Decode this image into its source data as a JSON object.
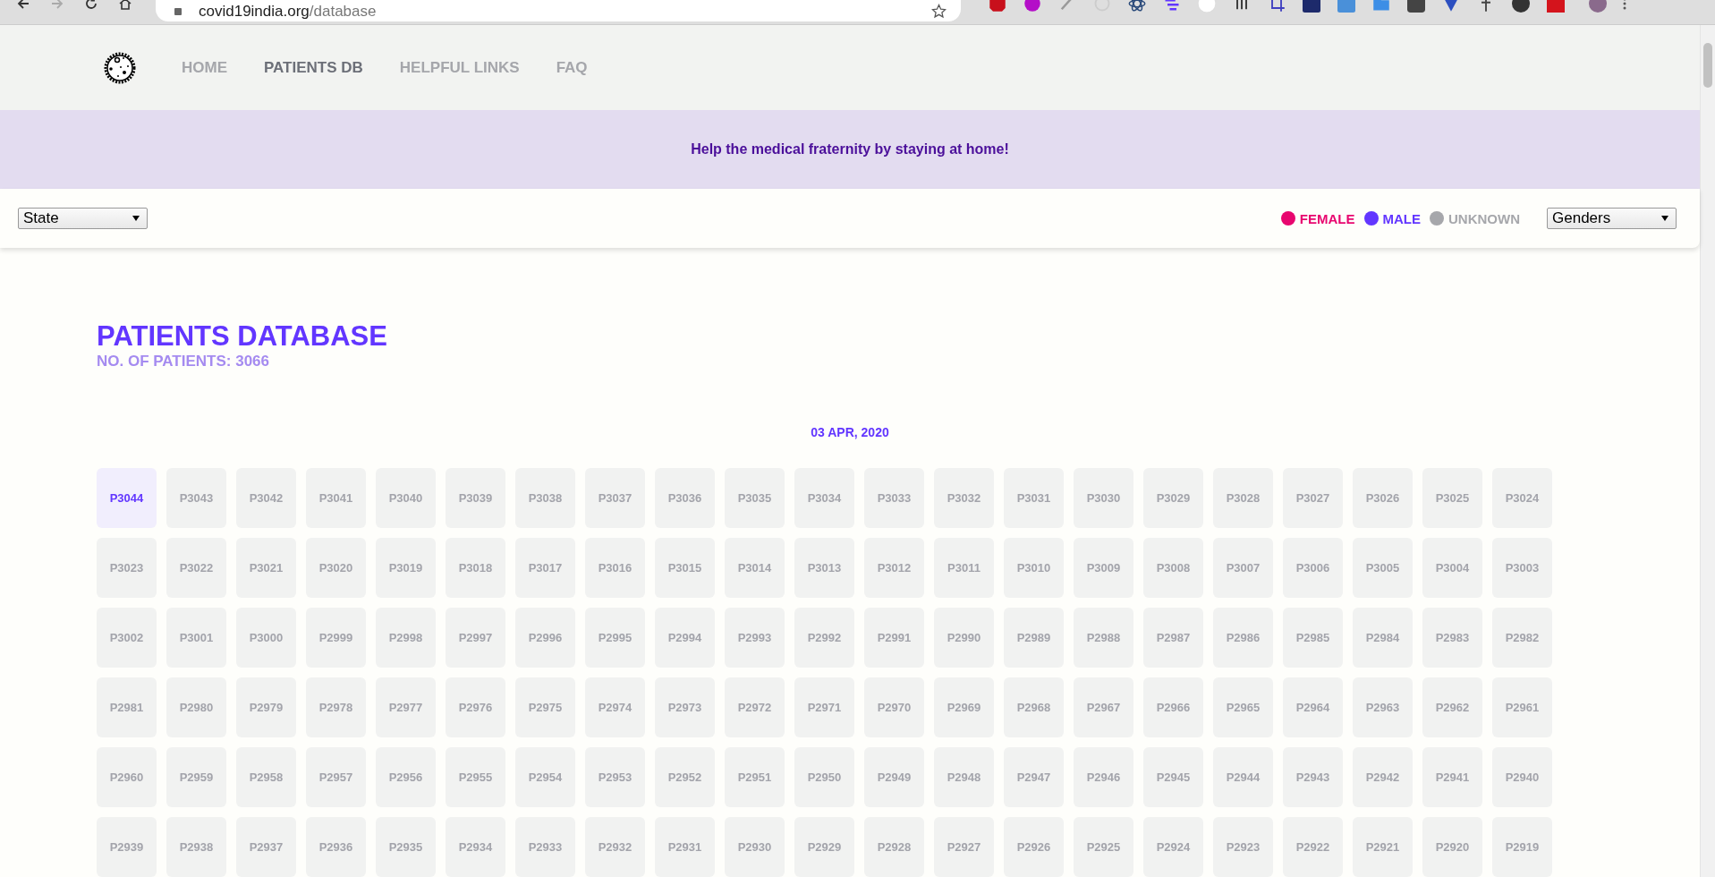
{
  "browser": {
    "url_host": "covid19india.org",
    "url_path": "/database"
  },
  "nav": {
    "items": [
      {
        "label": "HOME",
        "selected": false
      },
      {
        "label": "PATIENTS DB",
        "selected": true
      },
      {
        "label": "HELPFUL LINKS",
        "selected": false
      },
      {
        "label": "FAQ",
        "selected": false
      }
    ]
  },
  "banner": {
    "text": "Help the medical fraternity by staying at home!"
  },
  "filters": {
    "state_select": "State",
    "gender_select": "Genders",
    "legend": [
      {
        "label": "FEMALE",
        "color": "#e8066f"
      },
      {
        "label": "MALE",
        "color": "#6236ff"
      },
      {
        "label": "UNKNOWN",
        "color": "#a6a7ab"
      }
    ]
  },
  "header": {
    "title": "PATIENTS DATABASE",
    "count": "NO. OF PATIENTS: 3066"
  },
  "date": "03 APR, 2020",
  "patients": [
    {
      "label": "P3044",
      "selected": true
    },
    {
      "label": "P3043",
      "selected": false
    },
    {
      "label": "P3042",
      "selected": false
    },
    {
      "label": "P3041",
      "selected": false
    },
    {
      "label": "P3040",
      "selected": false
    },
    {
      "label": "P3039",
      "selected": false
    },
    {
      "label": "P3038",
      "selected": false
    },
    {
      "label": "P3037",
      "selected": false
    },
    {
      "label": "P3036",
      "selected": false
    },
    {
      "label": "P3035",
      "selected": false
    },
    {
      "label": "P3034",
      "selected": false
    },
    {
      "label": "P3033",
      "selected": false
    },
    {
      "label": "P3032",
      "selected": false
    },
    {
      "label": "P3031",
      "selected": false
    },
    {
      "label": "P3030",
      "selected": false
    },
    {
      "label": "P3029",
      "selected": false
    },
    {
      "label": "P3028",
      "selected": false
    },
    {
      "label": "P3027",
      "selected": false
    },
    {
      "label": "P3026",
      "selected": false
    },
    {
      "label": "P3025",
      "selected": false
    },
    {
      "label": "P3024",
      "selected": false
    },
    {
      "label": "P3023",
      "selected": false
    },
    {
      "label": "P3022",
      "selected": false
    },
    {
      "label": "P3021",
      "selected": false
    },
    {
      "label": "P3020",
      "selected": false
    },
    {
      "label": "P3019",
      "selected": false
    },
    {
      "label": "P3018",
      "selected": false
    },
    {
      "label": "P3017",
      "selected": false
    },
    {
      "label": "P3016",
      "selected": false
    },
    {
      "label": "P3015",
      "selected": false
    },
    {
      "label": "P3014",
      "selected": false
    },
    {
      "label": "P3013",
      "selected": false
    },
    {
      "label": "P3012",
      "selected": false
    },
    {
      "label": "P3011",
      "selected": false
    },
    {
      "label": "P3010",
      "selected": false
    },
    {
      "label": "P3009",
      "selected": false
    },
    {
      "label": "P3008",
      "selected": false
    },
    {
      "label": "P3007",
      "selected": false
    },
    {
      "label": "P3006",
      "selected": false
    },
    {
      "label": "P3005",
      "selected": false
    },
    {
      "label": "P3004",
      "selected": false
    },
    {
      "label": "P3003",
      "selected": false
    },
    {
      "label": "P3002",
      "selected": false
    },
    {
      "label": "P3001",
      "selected": false
    },
    {
      "label": "P3000",
      "selected": false
    },
    {
      "label": "P2999",
      "selected": false
    },
    {
      "label": "P2998",
      "selected": false
    },
    {
      "label": "P2997",
      "selected": false
    },
    {
      "label": "P2996",
      "selected": false
    },
    {
      "label": "P2995",
      "selected": false
    },
    {
      "label": "P2994",
      "selected": false
    },
    {
      "label": "P2993",
      "selected": false
    },
    {
      "label": "P2992",
      "selected": false
    },
    {
      "label": "P2991",
      "selected": false
    },
    {
      "label": "P2990",
      "selected": false
    },
    {
      "label": "P2989",
      "selected": false
    },
    {
      "label": "P2988",
      "selected": false
    },
    {
      "label": "P2987",
      "selected": false
    },
    {
      "label": "P2986",
      "selected": false
    },
    {
      "label": "P2985",
      "selected": false
    },
    {
      "label": "P2984",
      "selected": false
    },
    {
      "label": "P2983",
      "selected": false
    },
    {
      "label": "P2982",
      "selected": false
    },
    {
      "label": "P2981",
      "selected": false
    },
    {
      "label": "P2980",
      "selected": false
    },
    {
      "label": "P2979",
      "selected": false
    },
    {
      "label": "P2978",
      "selected": false
    },
    {
      "label": "P2977",
      "selected": false
    },
    {
      "label": "P2976",
      "selected": false
    },
    {
      "label": "P2975",
      "selected": false
    },
    {
      "label": "P2974",
      "selected": false
    },
    {
      "label": "P2973",
      "selected": false
    },
    {
      "label": "P2972",
      "selected": false
    },
    {
      "label": "P2971",
      "selected": false
    },
    {
      "label": "P2970",
      "selected": false
    },
    {
      "label": "P2969",
      "selected": false
    },
    {
      "label": "P2968",
      "selected": false
    },
    {
      "label": "P2967",
      "selected": false
    },
    {
      "label": "P2966",
      "selected": false
    },
    {
      "label": "P2965",
      "selected": false
    },
    {
      "label": "P2964",
      "selected": false
    },
    {
      "label": "P2963",
      "selected": false
    },
    {
      "label": "P2962",
      "selected": false
    },
    {
      "label": "P2961",
      "selected": false
    },
    {
      "label": "P2960",
      "selected": false
    },
    {
      "label": "P2959",
      "selected": false
    },
    {
      "label": "P2958",
      "selected": false
    },
    {
      "label": "P2957",
      "selected": false
    },
    {
      "label": "P2956",
      "selected": false
    },
    {
      "label": "P2955",
      "selected": false
    },
    {
      "label": "P2954",
      "selected": false
    },
    {
      "label": "P2953",
      "selected": false
    },
    {
      "label": "P2952",
      "selected": false
    },
    {
      "label": "P2951",
      "selected": false
    },
    {
      "label": "P2950",
      "selected": false
    },
    {
      "label": "P2949",
      "selected": false
    },
    {
      "label": "P2948",
      "selected": false
    },
    {
      "label": "P2947",
      "selected": false
    },
    {
      "label": "P2946",
      "selected": false
    },
    {
      "label": "P2945",
      "selected": false
    },
    {
      "label": "P2944",
      "selected": false
    },
    {
      "label": "P2943",
      "selected": false
    },
    {
      "label": "P2942",
      "selected": false
    },
    {
      "label": "P2941",
      "selected": false
    },
    {
      "label": "P2940",
      "selected": false
    },
    {
      "label": "P2939",
      "selected": false
    },
    {
      "label": "P2938",
      "selected": false
    },
    {
      "label": "P2937",
      "selected": false
    },
    {
      "label": "P2936",
      "selected": false
    },
    {
      "label": "P2935",
      "selected": false
    },
    {
      "label": "P2934",
      "selected": false
    },
    {
      "label": "P2933",
      "selected": false
    },
    {
      "label": "P2932",
      "selected": false
    },
    {
      "label": "P2931",
      "selected": false
    },
    {
      "label": "P2930",
      "selected": false
    },
    {
      "label": "P2929",
      "selected": false
    },
    {
      "label": "P2928",
      "selected": false
    },
    {
      "label": "P2927",
      "selected": false
    },
    {
      "label": "P2926",
      "selected": false
    },
    {
      "label": "P2925",
      "selected": false
    },
    {
      "label": "P2924",
      "selected": false
    },
    {
      "label": "P2923",
      "selected": false
    },
    {
      "label": "P2922",
      "selected": false
    },
    {
      "label": "P2921",
      "selected": false
    },
    {
      "label": "P2920",
      "selected": false
    },
    {
      "label": "P2919",
      "selected": false
    }
  ]
}
